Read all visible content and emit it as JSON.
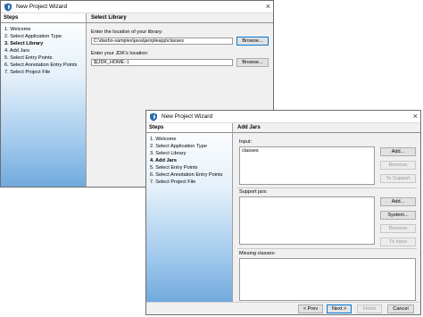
{
  "window1": {
    "title": "New Project Wizard",
    "close_glyph": "×",
    "icon": "wizard-shield-icon",
    "steps_title": "Steps",
    "steps": [
      "1. Welcome",
      "2. Select Application Type",
      "3. Select Library",
      "4. Add Jars",
      "5. Select Entry Points",
      "6. Select Annotation Entry Points",
      "7. Select Project File"
    ],
    "current_step": 2,
    "panel_title": "Select Library",
    "library_label": "Enter the location of your library:",
    "library_value": "C:\\dasho-samples\\java\\jarnpleapp\\classes",
    "browse_label": "Browse...",
    "jdk_label": "Enter your JDK's location:",
    "jdk_value": "${JDK_HOME:-}",
    "browse2_label": "Browse..."
  },
  "window2": {
    "title": "New Project Wizard",
    "close_glyph": "×",
    "icon": "wizard-shield-icon",
    "steps_title": "Steps",
    "steps": [
      "1. Welcome",
      "2. Select Application Type",
      "3. Select Library",
      "4. Add Jars",
      "5. Select Entry Points",
      "6. Select Annotation Entry Points",
      "7. Select Project File"
    ],
    "current_step": 3,
    "panel_title": "Add Jars",
    "input_label": "Input:",
    "input_items": [
      "classes"
    ],
    "input_buttons": {
      "add": "Add...",
      "remove": "Remove",
      "to_support": "To Support"
    },
    "support_label": "Support jars:",
    "support_buttons": {
      "add": "Add...",
      "system": "System...",
      "remove": "Remove",
      "to_input": "To Input"
    },
    "missing_label": "Missing classes:",
    "footer": {
      "prev": "< Prev",
      "next": "Next >",
      "finish": "Finish",
      "cancel": "Cancel"
    }
  },
  "colors": {
    "focus_border": "#0078d7",
    "steps_gradient_bottom": "#6fa8dc",
    "disabled_text": "#9a9a9a"
  }
}
